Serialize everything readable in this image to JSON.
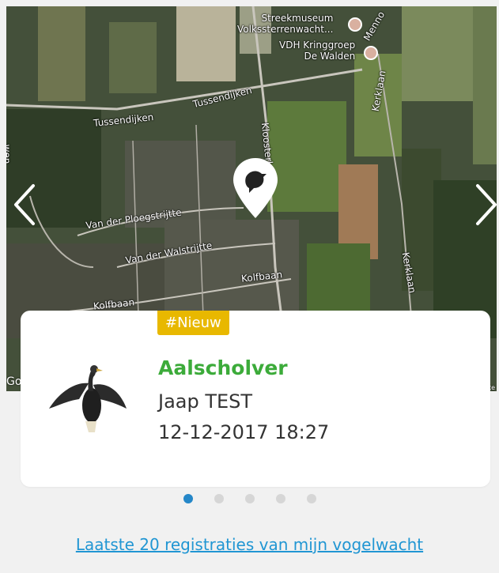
{
  "map": {
    "street_labels": {
      "tussendijken_1": "Tussendijken",
      "tussendijken_2": "Tussendijken",
      "kloosterlaan": "Kloosterla",
      "ploegstrijtte": "Van der Ploegstrijtte",
      "walstrijtte": "Van der Walstrijtte",
      "kolfbaan_1": "Kolfbaan",
      "kolfbaan_2": "Kolfbaan",
      "kerklaan_1": "Kerklaan",
      "kerklaan_2": "Kerklaan",
      "menno": "Menno",
      "left_edge": "wen"
    },
    "poi_museum": "Streekmuseum\nVolkssterrenwacht...",
    "poi_kringgroep": "VDH Kringgroep\nDe Walden",
    "google": "Go",
    "terms": "nte"
  },
  "card": {
    "badge": "#Nieuw",
    "species": "Aalscholver",
    "observer": "Jaap  TEST",
    "datetime": "12-12-2017 18:27"
  },
  "pagination": {
    "count": 5,
    "active_index": 0
  },
  "footer": {
    "link": "Laatste 20 registraties van mijn vogelwacht"
  },
  "colors": {
    "species": "#3cab3a",
    "badge": "#e8b800",
    "link": "#2196d3",
    "active_dot": "#2587c8"
  }
}
